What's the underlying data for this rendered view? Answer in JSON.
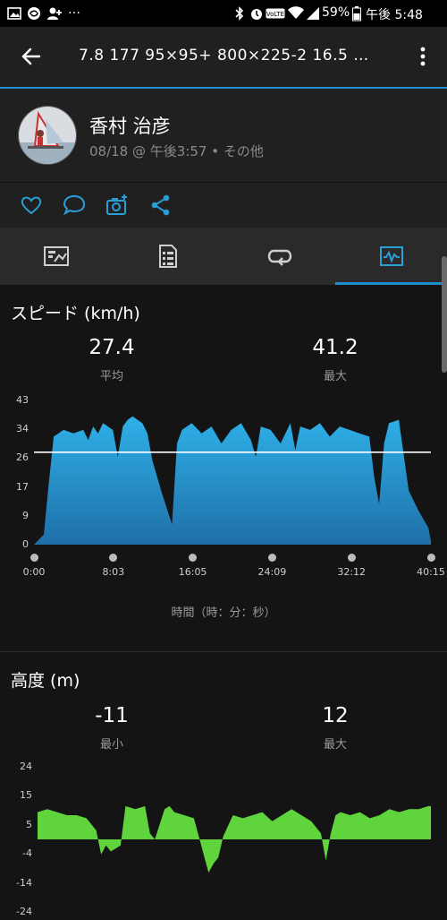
{
  "status_bar": {
    "left_icons": [
      "image-icon",
      "sync-icon",
      "user-add-icon"
    ],
    "left_more": "…",
    "battery": "59%",
    "time": "午後 5:48",
    "right_icons": [
      "bluetooth-icon",
      "alarm-icon",
      "volte-icon",
      "wifi-icon",
      "signal-icon",
      "battery-icon"
    ]
  },
  "app_bar": {
    "title": "7.8  177  95×95+   800×225-2  16.5 …"
  },
  "profile": {
    "name": "香村 治彦",
    "meta": "08/18 @ 午後3:57 • その他"
  },
  "actions": [
    "like-icon",
    "comment-icon",
    "add-photo-icon",
    "share-icon"
  ],
  "tabs": [
    {
      "name": "summary",
      "icon": "summary-icon",
      "active": false
    },
    {
      "name": "details",
      "icon": "details-icon",
      "active": false
    },
    {
      "name": "laps",
      "icon": "laps-icon",
      "active": false
    },
    {
      "name": "charts",
      "icon": "chart-icon",
      "active": true
    }
  ],
  "speed": {
    "title": "スピード (km/h)",
    "avg_value": "27.4",
    "avg_label": "平均",
    "max_value": "41.2",
    "max_label": "最大",
    "x_axis_label": "時間（時：分：秒）"
  },
  "elevation": {
    "title": "高度 (m)",
    "min_value": "-11",
    "min_label": "最小",
    "max_value": "12",
    "max_label": "最大"
  },
  "chart_data": [
    {
      "type": "area",
      "title": "スピード (km/h)",
      "xlabel": "時間（時：分：秒）",
      "ylabel": "",
      "y_ticks": [
        "43",
        "34",
        "26",
        "17",
        "9",
        "0"
      ],
      "x_ticks": [
        "0:00",
        "8:03",
        "16:05",
        "24:09",
        "32:12",
        "40:15"
      ],
      "ylim": [
        0,
        43
      ],
      "xlim": [
        0,
        40.25
      ],
      "average_line": 27.4,
      "color": "#2a9fd6",
      "x": [
        0,
        1,
        1.5,
        2,
        3,
        4,
        5,
        5.5,
        6,
        6.5,
        7,
        8,
        8.5,
        9,
        9.5,
        10,
        11,
        11.5,
        12,
        13,
        14,
        14.5,
        15,
        16,
        17,
        18,
        19,
        20,
        21,
        22,
        22.5,
        23,
        24,
        25,
        26,
        26.5,
        27,
        28,
        29,
        30,
        31,
        32,
        33,
        34,
        34.5,
        35,
        35.5,
        36,
        37,
        38,
        39,
        40,
        40.25
      ],
      "values": [
        0,
        3,
        18,
        32,
        34,
        33,
        34,
        31,
        35,
        33,
        36,
        34,
        26,
        35,
        37,
        38,
        36,
        33,
        25,
        15,
        6,
        30,
        34,
        36,
        33,
        35,
        30,
        34,
        36,
        31,
        26,
        35,
        34,
        30,
        36,
        28,
        35,
        34,
        36,
        32,
        35,
        34,
        33,
        32,
        20,
        12,
        30,
        36,
        37,
        16,
        10,
        5,
        1
      ]
    },
    {
      "type": "area",
      "title": "高度 (m)",
      "xlabel": "",
      "ylabel": "",
      "y_ticks": [
        "24",
        "15",
        "5",
        "-4",
        "-14",
        "-24"
      ],
      "ylim": [
        -24,
        24
      ],
      "xlim": [
        0,
        40.25
      ],
      "color": "#5fd43c",
      "x": [
        0,
        1,
        2,
        3,
        4,
        5,
        6,
        6.5,
        7,
        7.5,
        8,
        8.5,
        9,
        10,
        11,
        11.5,
        12,
        13,
        13.5,
        14,
        15,
        16,
        17,
        17.5,
        18,
        18.5,
        19,
        20,
        21,
        22,
        23,
        24,
        25,
        26,
        27,
        28,
        29,
        29.5,
        30,
        30.5,
        31,
        32,
        33,
        34,
        35,
        36,
        37,
        38,
        39,
        40,
        40.25
      ],
      "values": [
        9,
        10,
        9,
        8,
        8,
        7,
        3,
        -5,
        -2,
        -4,
        -3,
        -2,
        11,
        10,
        11,
        2,
        0,
        10,
        11,
        9,
        8,
        7,
        -5,
        -11,
        -8,
        -6,
        1,
        8,
        7,
        8,
        9,
        6,
        8,
        10,
        8,
        6,
        2,
        -7,
        2,
        8,
        9,
        8,
        9,
        7,
        8,
        10,
        9,
        10,
        10,
        11,
        11
      ]
    }
  ]
}
